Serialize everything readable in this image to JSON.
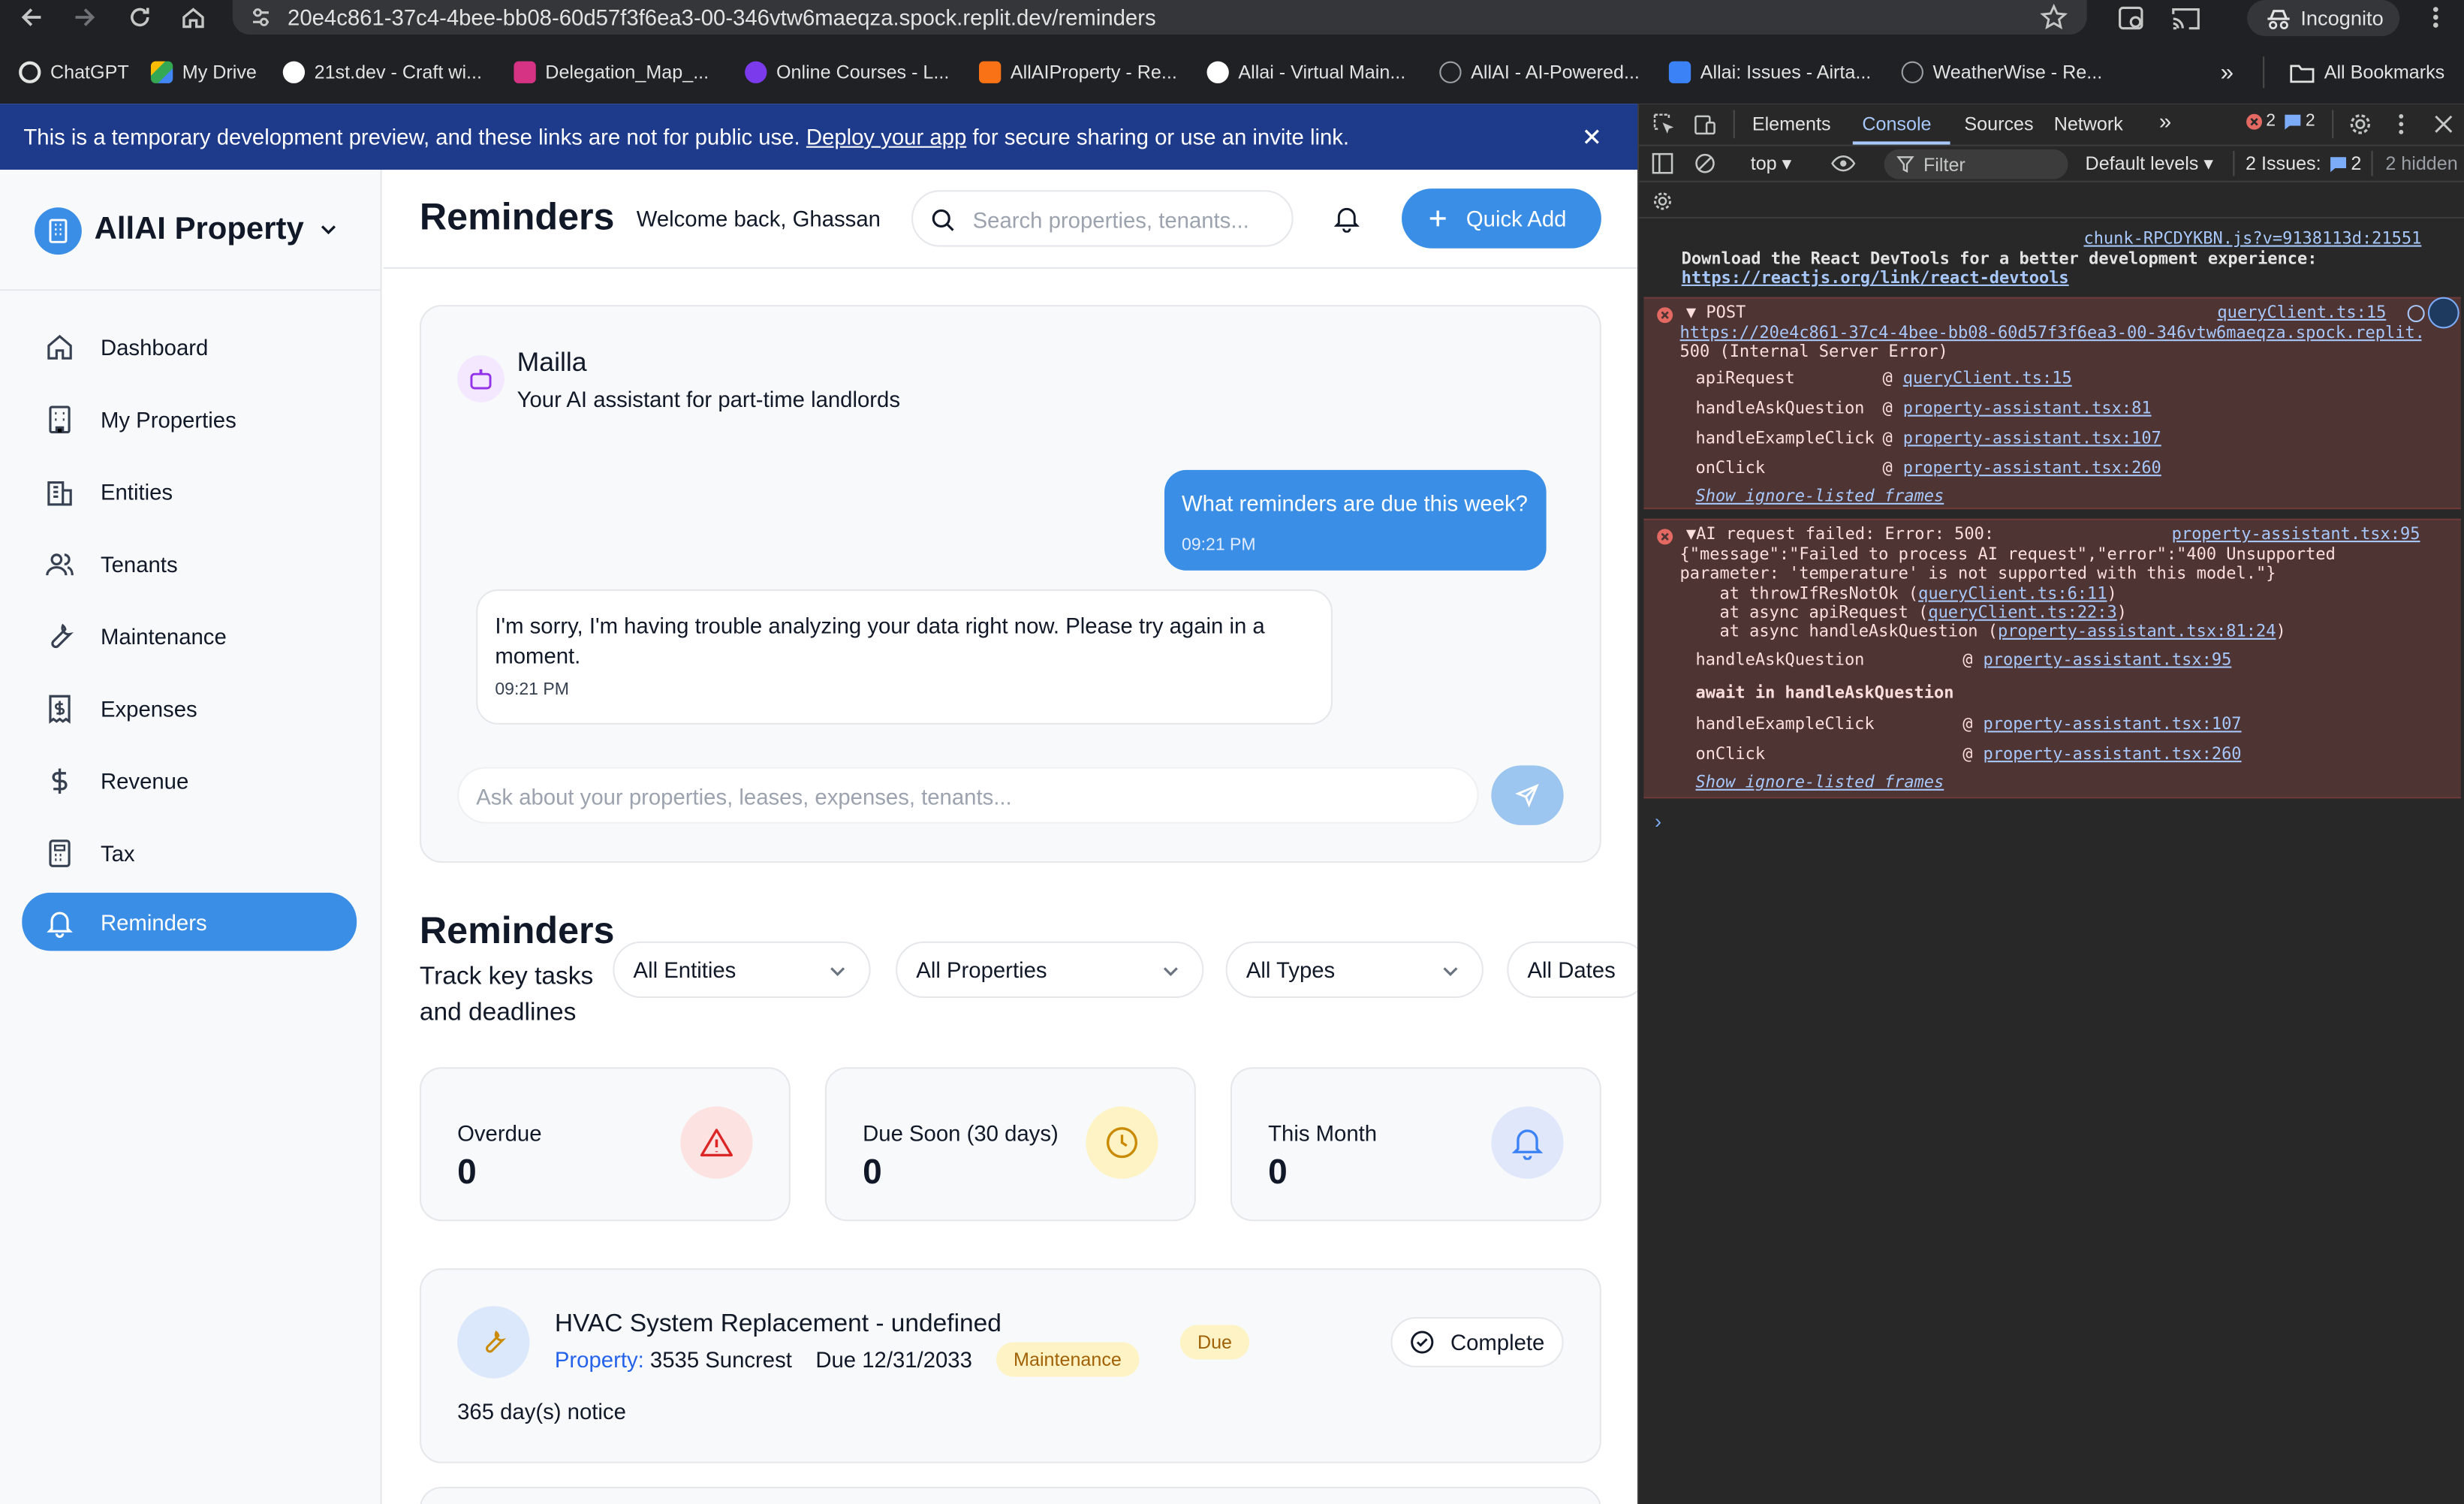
{
  "browser": {
    "url": "20e4c861-37c4-4bee-bb08-60d57f3f6ea3-00-346vtw6maeqza.spock.replit.dev/reminders",
    "incognito_label": "Incognito",
    "bookmarks": [
      {
        "label": "ChatGPT",
        "color": "#e3e3e3"
      },
      {
        "label": "My Drive",
        "color": "#34a853"
      },
      {
        "label": "21st.dev - Craft wi...",
        "color": "#ffffff"
      },
      {
        "label": "Delegation_Map_...",
        "color": "#d63384"
      },
      {
        "label": "Online Courses - L...",
        "color": "#7c3aed"
      },
      {
        "label": "AllAIProperty - Re...",
        "color": "#f97316"
      },
      {
        "label": "Allai - Virtual Main...",
        "color": "#ffffff"
      },
      {
        "label": "AllAI - AI-Powered...",
        "color": "#9aa0a6"
      },
      {
        "label": "Allai: Issues - Airta...",
        "color": "#3b82f6"
      },
      {
        "label": "WeatherWise - Re...",
        "color": "#9aa0a6"
      }
    ],
    "all_bookmarks_label": "All Bookmarks"
  },
  "banner": {
    "text_before": "This is a temporary development preview, and these links are not for public use.",
    "link": "Deploy your app",
    "text_after": "for secure sharing or use an invite link."
  },
  "sidebar": {
    "brand": "AllAI Property",
    "items": [
      {
        "label": "Dashboard",
        "icon": "home-icon"
      },
      {
        "label": "My Properties",
        "icon": "building-icon"
      },
      {
        "label": "Entities",
        "icon": "entities-icon"
      },
      {
        "label": "Tenants",
        "icon": "users-icon"
      },
      {
        "label": "Maintenance",
        "icon": "wrench-icon"
      },
      {
        "label": "Expenses",
        "icon": "receipt-icon"
      },
      {
        "label": "Revenue",
        "icon": "dollar-icon"
      },
      {
        "label": "Tax",
        "icon": "calculator-icon"
      },
      {
        "label": "Reminders",
        "icon": "bell-icon",
        "active": true
      }
    ]
  },
  "header": {
    "title": "Reminders",
    "welcome": "Welcome back, Ghassan",
    "search_placeholder": "Search properties, tenants...",
    "quick_add": "Quick Add"
  },
  "assistant": {
    "name": "Mailla",
    "subtitle": "Your AI assistant for part-time landlords",
    "messages": [
      {
        "role": "user",
        "text": "What reminders are due this week?",
        "time": "09:21 PM"
      },
      {
        "role": "assistant",
        "text": "I'm sorry, I'm having trouble analyzing your data right now. Please try again in a moment.",
        "time": "09:21 PM"
      }
    ],
    "input_placeholder": "Ask about your properties, leases, expenses, tenants..."
  },
  "reminders": {
    "title": "Reminders",
    "subtitle": "Track key tasks and deadlines",
    "filters": [
      "All Entities",
      "All Properties",
      "All Types",
      "All Dates"
    ],
    "stats": [
      {
        "label": "Overdue",
        "value": "0",
        "icon": "alert-triangle-icon",
        "bg": "#fde2e2",
        "fg": "#dc2626"
      },
      {
        "label": "Due Soon (30 days)",
        "value": "0",
        "icon": "clock-icon",
        "bg": "#fdf3c4",
        "fg": "#ca8a04"
      },
      {
        "label": "This Month",
        "value": "0",
        "icon": "bell-icon",
        "bg": "#e0e7fb",
        "fg": "#3b82f6"
      }
    ],
    "items": [
      {
        "title": "HVAC System Replacement - undefined",
        "property_label": "Property:",
        "property": "3535 Suncrest",
        "due": "Due 12/31/2033",
        "type": "Maintenance",
        "status": "Due",
        "notice": "365 day(s) notice",
        "action": "Complete"
      }
    ]
  },
  "devtools": {
    "tabs": [
      "Elements",
      "Console",
      "Sources",
      "Network"
    ],
    "active_tab": "Console",
    "error_count": "2",
    "issue_count": "2",
    "context": "top",
    "filter_placeholder": "Filter",
    "levels": "Default levels",
    "issues_label": "2 Issues:",
    "issues_count": "2",
    "hidden": "2 hidden",
    "log": {
      "source": "chunk-RPCDYKBN.js?v=9138113d:21551",
      "line1": "Download the React DevTools for a better development experience:",
      "link": "https://reactjs.org/link/react-devtools"
    },
    "error1": {
      "head": "POST",
      "source": "queryClient.ts:15",
      "url": "https://20e4c861-37c4-4bee-bb08-60d57f3f6ea3-00-346vtw6maeqza.spock.replit.",
      "status": "500 (Internal Server Error)",
      "stack": [
        {
          "fn": "apiRequest",
          "loc": "queryClient.ts:15"
        },
        {
          "fn": "handleAskQuestion",
          "loc": "property-assistant.tsx:81"
        },
        {
          "fn": "handleExampleClick",
          "loc": "property-assistant.tsx:107"
        },
        {
          "fn": "onClick",
          "loc": "property-assistant.tsx:260"
        }
      ],
      "ignore": "Show ignore-listed frames"
    },
    "error2": {
      "head": "AI request failed: Error: 500:",
      "source": "property-assistant.tsx:95",
      "l1": "{\"message\":\"Failed to process AI request\",\"error\":\"400 Unsupported",
      "l2": "parameter: 'temperature' is not supported with this model.\"}",
      "at1a": "    at throwIfResNotOk (",
      "at1b": "queryClient.ts:6:11",
      "at2a": "    at async apiRequest (",
      "at2b": "queryClient.ts:22:3",
      "at3a": "    at async handleAskQuestion (",
      "at3b": "property-assistant.tsx:81:24",
      "stack1": {
        "fn": "handleAskQuestion",
        "loc": "property-assistant.tsx:95"
      },
      "await": "await in handleAskQuestion",
      "stack2": [
        {
          "fn": "handleExampleClick",
          "loc": "property-assistant.tsx:107"
        },
        {
          "fn": "onClick",
          "loc": "property-assistant.tsx:260"
        }
      ],
      "ignore": "Show ignore-listed frames"
    }
  }
}
